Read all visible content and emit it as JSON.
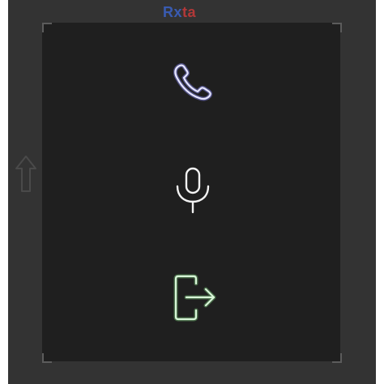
{
  "watermark": {
    "part1": "Rx",
    "part2": "ta"
  },
  "controls": [
    {
      "icon": "phone-icon",
      "color": "#d8d8ff"
    },
    {
      "icon": "microphone-icon",
      "color": "#f2f2f2"
    },
    {
      "icon": "exit-icon",
      "color": "#c8eec8"
    }
  ],
  "colors": {
    "frame": "#333333",
    "panel": "#1f1f1f",
    "phone_glow": "#8f8fff",
    "exit_glow": "#7fd47f"
  }
}
